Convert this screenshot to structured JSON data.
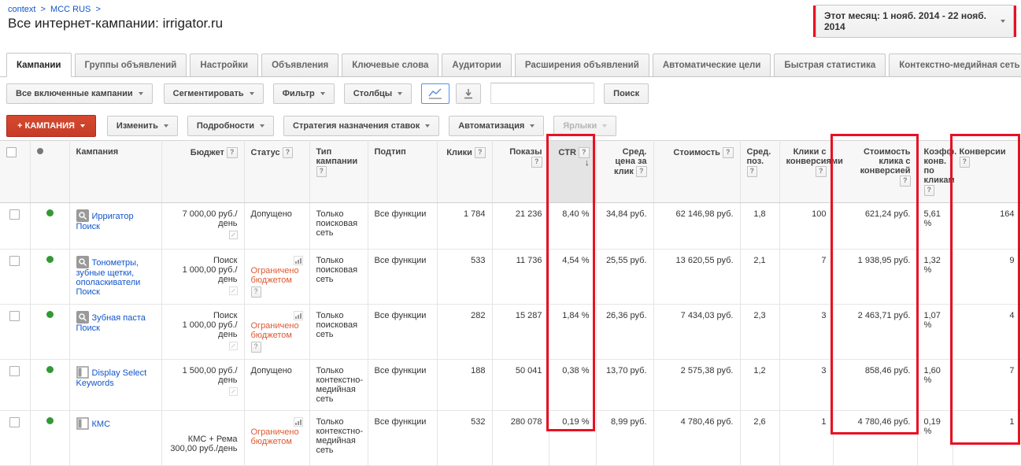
{
  "colors": {
    "annotation_red": "#e81123",
    "add_button_red": "#d6492f",
    "link_blue": "#1155cc",
    "status_warning_orange": "#dd5931",
    "enabled_dot_green": "#339933"
  },
  "breadcrumb": {
    "link1": "context",
    "link2": "MCC RUS",
    "separator": ">"
  },
  "page_title": "Все интернет-кампании: irrigator.ru",
  "date_range": "Этот месяц: 1 нояб. 2014 - 22 нояб. 2014",
  "tabs": [
    {
      "label": "Кампании",
      "active": true
    },
    {
      "label": "Группы объявлений"
    },
    {
      "label": "Настройки"
    },
    {
      "label": "Объявления"
    },
    {
      "label": "Ключевые слова"
    },
    {
      "label": "Аудитории"
    },
    {
      "label": "Расширения объявлений"
    },
    {
      "label": "Автоматические цели"
    },
    {
      "label": "Быстрая статистика"
    },
    {
      "label": "Контекстно-медийная сеть"
    }
  ],
  "toolbar": {
    "campaigns_filter": "Все включенные кампании",
    "segment": "Сегментировать",
    "filter": "Фильтр",
    "columns": "Столбцы",
    "search_value": "",
    "search_button": "Поиск",
    "add_campaign": "+ КАМПАНИЯ",
    "edit": "Изменить",
    "details": "Подробности",
    "bid_strategy": "Стратегия назначения ставок",
    "automation": "Автоматизация",
    "labels": "Ярлыки"
  },
  "glyphs": {
    "help": "?",
    "sort_desc": "↓"
  },
  "table": {
    "headers": {
      "campaign": "Кампания",
      "budget": "Бюджет",
      "status": "Статус",
      "type": "Тип кампании",
      "subtype": "Подтип",
      "clicks": "Клики",
      "impressions": "Показы",
      "ctr": "CTR",
      "avg_cpc": "Сред. цена за клик",
      "cost": "Стоимость",
      "avg_pos": "Сред. поз.",
      "conv_clicks": "Клики с конверсиями",
      "cost_per_conv": "Стоимость клика с конверсией",
      "conv_rate": "Коэфф. конв. по кликам",
      "conversions": "Конверсии"
    },
    "rows": [
      {
        "campaign": "Ирригатор Поиск",
        "budget_label": "",
        "budget": "7 000,00 руб./день",
        "status": "Допущено",
        "type": "Только поисковая сеть",
        "subtype": "Все функции",
        "clicks": "1 784",
        "impressions": "21 236",
        "ctr": "8,40 %",
        "avg_cpc": "34,84 руб.",
        "cost": "62 146,98 руб.",
        "avg_pos": "1,8",
        "conv_clicks": "100",
        "cost_per_conv": "621,24 руб.",
        "conv_rate": "5,61 %",
        "conversions": "164"
      },
      {
        "campaign": "Тонометры, зубные щетки, ополаскиватели Поиск",
        "budget_label": "Поиск",
        "budget": "1 000,00 руб./день",
        "status": "Ограничено бюджетом",
        "type": "Только поисковая сеть",
        "subtype": "Все функции",
        "clicks": "533",
        "impressions": "11 736",
        "ctr": "4,54 %",
        "avg_cpc": "25,55 руб.",
        "cost": "13 620,55 руб.",
        "avg_pos": "2,1",
        "conv_clicks": "7",
        "cost_per_conv": "1 938,95 руб.",
        "conv_rate": "1,32 %",
        "conversions": "9"
      },
      {
        "campaign": "Зубная паста Поиск",
        "budget_label": "Поиск",
        "budget": "1 000,00 руб./день",
        "status": "Ограничено бюджетом",
        "type": "Только поисковая сеть",
        "subtype": "Все функции",
        "clicks": "282",
        "impressions": "15 287",
        "ctr": "1,84 %",
        "avg_cpc": "26,36 руб.",
        "cost": "7 434,03 руб.",
        "avg_pos": "2,3",
        "conv_clicks": "3",
        "cost_per_conv": "2 463,71 руб.",
        "conv_rate": "1,07 %",
        "conversions": "4"
      },
      {
        "campaign": "Display Select Keywords",
        "budget_label": "",
        "budget": "1 500,00 руб./день",
        "status": "Допущено",
        "type": "Только контекстно-медийная сеть",
        "subtype": "Все функции",
        "clicks": "188",
        "impressions": "50 041",
        "ctr": "0,38 %",
        "avg_cpc": "13,70 руб.",
        "cost": "2 575,38 руб.",
        "avg_pos": "1,2",
        "conv_clicks": "3",
        "cost_per_conv": "858,46 руб.",
        "conv_rate": "1,60 %",
        "conversions": "7"
      },
      {
        "campaign": "КМС",
        "budget_label": "КМС + Рема",
        "budget": "300,00 руб./день",
        "status": "Ограничено бюджетом",
        "type": "Только контекстно-медийная сеть",
        "subtype": "Все функции",
        "clicks": "532",
        "impressions": "280 078",
        "ctr": "0,19 %",
        "avg_cpc": "8,99 руб.",
        "cost": "4 780,46 руб.",
        "avg_pos": "2,6",
        "conv_clicks": "1",
        "cost_per_conv": "4 780,46 руб.",
        "conv_rate": "0,19 %",
        "conversions": "1"
      }
    ]
  }
}
